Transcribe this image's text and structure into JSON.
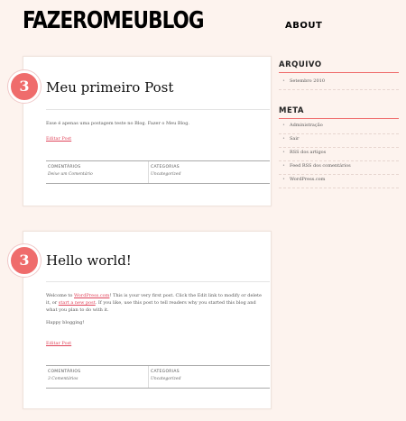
{
  "site": {
    "title": "FAZEROMEUBLOG"
  },
  "nav": {
    "about": "ABOUT"
  },
  "posts": [
    {
      "comment_count": "3",
      "title": "Meu primeiro Post",
      "body": "Esse é apenas uma postagem teste no Blog. Fazer o Meu Blog.",
      "edit": "Editar Post",
      "meta_comments_label": "COMENTÁRIOS",
      "meta_comments_value": "Deixe um Comentário",
      "meta_categories_label": "CATEGORIAS",
      "meta_categories_value": "Uncategorized"
    },
    {
      "comment_count": "3",
      "title": "Hello world!",
      "body_1": "Welcome to ",
      "body_link1": "WordPress.com",
      "body_2": "! This is your very first post. Click the Edit link to modify or delete it, or ",
      "body_link2": "start a new post",
      "body_3": ". If you like, use this post to tell readers why you started this blog and what you plan to do with it.",
      "body_4": "Happy blogging!",
      "edit": "Editar Post",
      "meta_comments_label": "COMENTÁRIOS",
      "meta_comments_value": "3 Comentários",
      "meta_categories_label": "CATEGORIAS",
      "meta_categories_value": "Uncategorized"
    }
  ],
  "sidebar": {
    "archive_title": "ARQUIVO",
    "archive_items": [
      "Setembro 2010"
    ],
    "meta_title": "META",
    "meta_items": [
      "Administração",
      "Sair",
      "RSS dos artigos",
      "Feed RSS dos comentários",
      "WordPress.com"
    ]
  }
}
